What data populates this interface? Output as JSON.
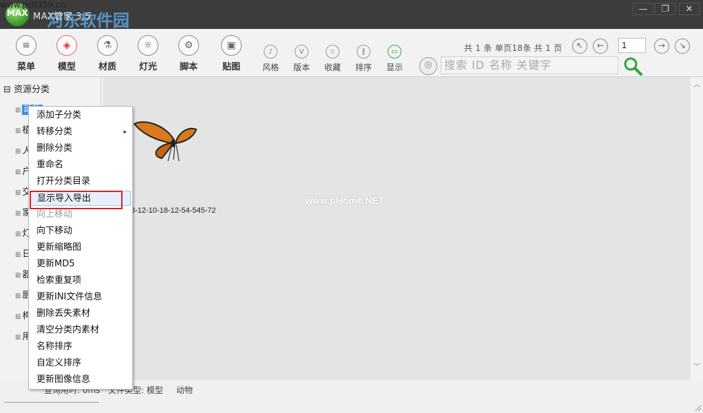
{
  "window": {
    "title": "MAX管家 3.5",
    "logo_text": "MAX",
    "watermark_site": "河东软件园",
    "watermark_url": "www.pc0359.cn",
    "min_label": "—",
    "max_label": "❐",
    "close_label": "✕"
  },
  "toolbar": {
    "big_tools": [
      {
        "label": "菜单",
        "icon": "≡"
      },
      {
        "label": "模型",
        "icon": "◈"
      },
      {
        "label": "材质",
        "icon": "⚗"
      },
      {
        "label": "灯光",
        "icon": "☼"
      },
      {
        "label": "脚本",
        "icon": "⚙"
      },
      {
        "label": "贴图",
        "icon": "▣"
      }
    ],
    "small_tools": [
      {
        "label": "风格",
        "icon": "♪"
      },
      {
        "label": "版本",
        "icon": "V"
      },
      {
        "label": "收藏",
        "icon": "☆"
      },
      {
        "label": "排序",
        "icon": "∥"
      },
      {
        "label": "显示",
        "icon": "▭"
      }
    ],
    "page_info": "共 1 条 单页18条 共 1 页",
    "page_number": "1",
    "search_placeholder": "搜索  ID  名称  关键字",
    "nav_first": "↖",
    "nav_prev": "←",
    "nav_next": "→",
    "nav_last": "↘",
    "filter_icon": "◎"
  },
  "tree": {
    "root": "资源分类",
    "items": [
      {
        "label": "动物",
        "selected": true
      },
      {
        "label": "植"
      },
      {
        "label": "人"
      },
      {
        "label": "户"
      },
      {
        "label": "交"
      },
      {
        "label": "家"
      },
      {
        "label": "灯"
      },
      {
        "label": "日"
      },
      {
        "label": "器"
      },
      {
        "label": "厨"
      },
      {
        "label": "构"
      },
      {
        "label": "用"
      }
    ]
  },
  "content": {
    "item_name": "8-12-10-18-12-54-545-72",
    "watermark": "www.pHome.NET"
  },
  "context_menu": {
    "items": [
      {
        "label": "添加子分类"
      },
      {
        "label": "转移分类",
        "submenu": "▸"
      },
      {
        "label": "删除分类"
      },
      {
        "label": "重命名"
      },
      {
        "label": "打开分类目录"
      },
      {
        "label": "显示导入导出",
        "hover": true
      },
      {
        "label": "向上移动",
        "disabled": true
      },
      {
        "label": "向下移动"
      },
      {
        "label": "更新缩略图"
      },
      {
        "label": "更新MD5"
      },
      {
        "label": "检索重复项"
      },
      {
        "label": "更新INI文件信息"
      },
      {
        "label": "删除丢失素材"
      },
      {
        "label": "清空分类内素材"
      },
      {
        "label": "名称排序"
      },
      {
        "label": "自定义排序"
      },
      {
        "label": "更新图像信息"
      }
    ]
  },
  "status": {
    "query_time": "查询用时: 0ms",
    "file_type": "文件类型: 模型",
    "category": "动物"
  },
  "colors": {
    "titlebar": "#3c3c3c",
    "selection": "#3d8ee0",
    "highlight_border": "#e02020"
  }
}
